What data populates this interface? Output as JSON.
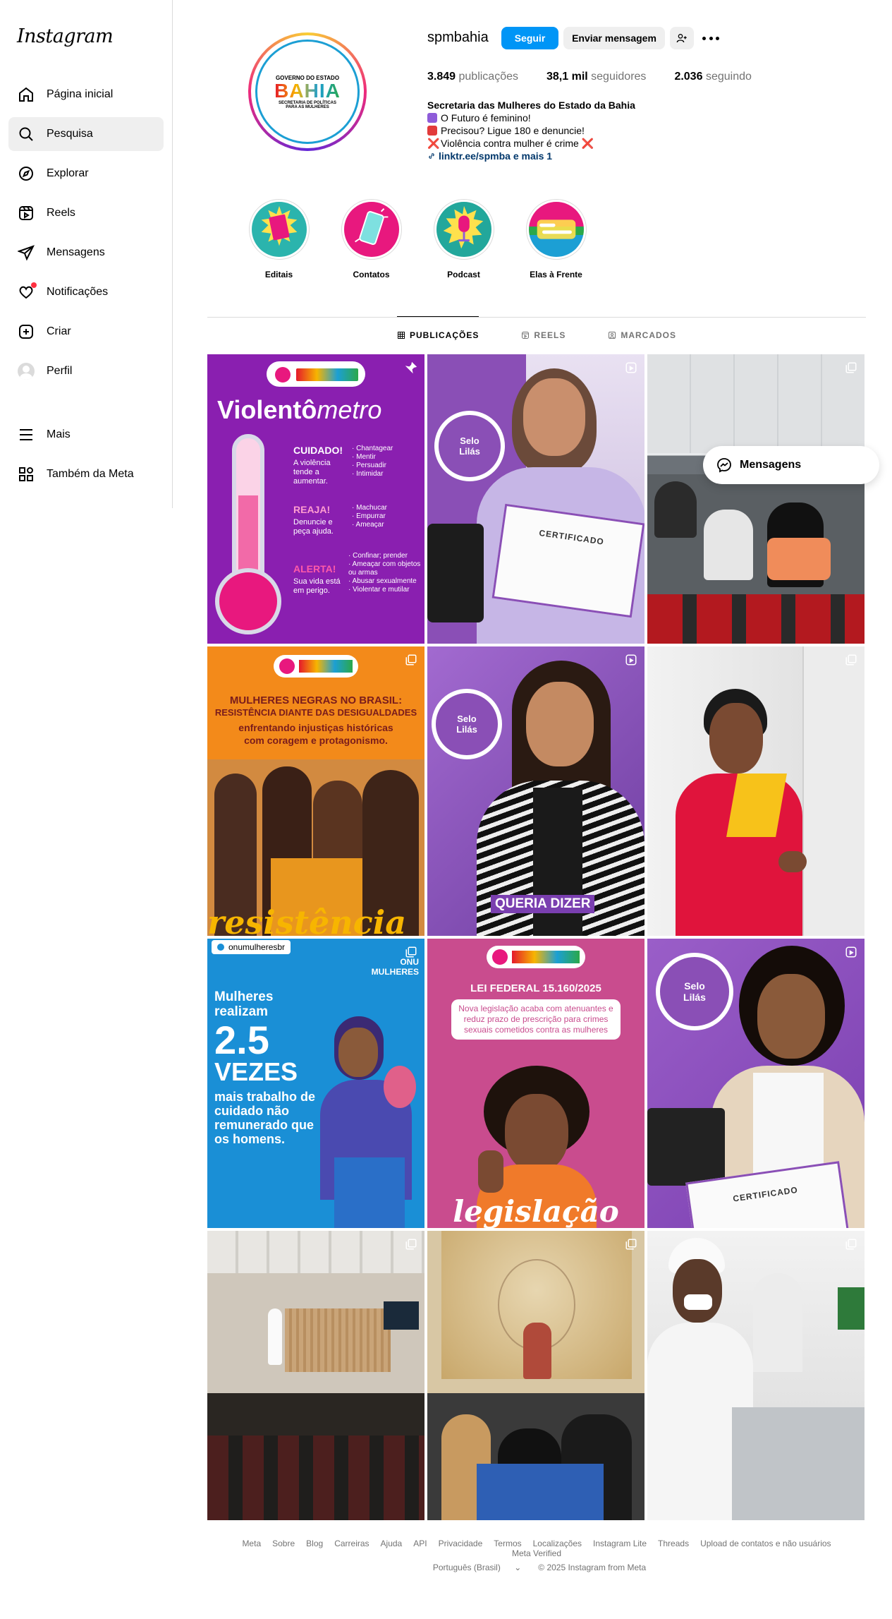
{
  "sidebar": {
    "logo": "Instagram",
    "items": [
      {
        "label": "Página inicial"
      },
      {
        "label": "Pesquisa"
      },
      {
        "label": "Explorar"
      },
      {
        "label": "Reels"
      },
      {
        "label": "Mensagens"
      },
      {
        "label": "Notificações"
      },
      {
        "label": "Criar"
      },
      {
        "label": "Perfil"
      }
    ],
    "bottom": [
      {
        "label": "Mais"
      },
      {
        "label": "Também da Meta"
      }
    ]
  },
  "profile": {
    "username": "spmbahia",
    "follow_label": "Seguir",
    "message_label": "Enviar mensagem",
    "logo": {
      "line1": "GOVERNO DO ESTADO",
      "line2": "BAHIA",
      "line3": "SECRETARIA DE POLÍTICAS PARA AS MULHERES"
    },
    "stats": [
      {
        "value": "3.849",
        "label": "publicações"
      },
      {
        "value": "38,1 mil",
        "label": "seguidores"
      },
      {
        "value": "2.036",
        "label": "seguindo"
      }
    ],
    "bio": {
      "name": "Secretaria das Mulheres do Estado da Bahia",
      "lines": [
        "O Futuro é feminino!",
        "Precisou? Ligue 180 e denuncie!",
        "Violência contra mulher é crime"
      ],
      "x_mark": "❌",
      "link": "linktr.ee/spmba e mais 1"
    }
  },
  "highlights": [
    {
      "label": "Editais",
      "bg": "#2bb4ad"
    },
    {
      "label": "Contatos",
      "bg": "#e8187e"
    },
    {
      "label": "Podcast",
      "bg": "#22a79b"
    },
    {
      "label": "Elas à Frente",
      "bg": "#e8187e"
    }
  ],
  "tabs": [
    {
      "label": "PUBLICAÇÕES"
    },
    {
      "label": "REELS"
    },
    {
      "label": "MARCADOS"
    }
  ],
  "posts": {
    "p1": {
      "title_a": "Violentô",
      "title_b": "metro",
      "levels": [
        {
          "head": "CUIDADO!",
          "desc": "A violência tende a aumentar.",
          "items": "· Chantagear\n· Mentir\n· Persuadir\n· Intimidar"
        },
        {
          "head": "REAJA!",
          "desc": "Denuncie e peça ajuda.",
          "items": "· Machucar\n· Empurrar\n· Ameaçar"
        },
        {
          "head": "ALERTA!",
          "desc": "Sua vida está em perigo.",
          "items": "· Confinar; prender\n· Ameaçar com objetos ou armas\n· Abusar sexualmente\n· Violentar e mutilar"
        }
      ]
    },
    "p2": {
      "badge": "Selo Lilás",
      "cert": "CERTIFICADO"
    },
    "p4": {
      "line1": "MULHERES NEGRAS NO BRASIL:",
      "line2": "RESISTÊNCIA DIANTE DAS DESIGUALDADES",
      "line3": "enfrentando injustiças históricas com coragem e protagonismo.",
      "script": "resistência"
    },
    "p5": {
      "badge": "Selo Lilás",
      "caption": "QUERIA DIZER"
    },
    "p7": {
      "collab": "onumulheresbr",
      "org": "ONU MULHERES",
      "l1": "Mulheres realizam",
      "l2": "2.5",
      "l3": "VEZES",
      "l4": "mais trabalho de cuidado não remunerado que os homens."
    },
    "p8": {
      "head": "LEI FEDERAL 15.160/2025",
      "desc": "Nova legislação acaba com atenuantes e reduz prazo de prescrição para crimes sexuais cometidos contra as mulheres",
      "script": "legislação"
    },
    "p9": {
      "badge": "Selo Lilás",
      "cert": "CERTIFICADO"
    }
  },
  "floating": {
    "label": "Mensagens"
  },
  "footer": {
    "links": [
      "Meta",
      "Sobre",
      "Blog",
      "Carreiras",
      "Ajuda",
      "API",
      "Privacidade",
      "Termos",
      "Localizações",
      "Instagram Lite",
      "Threads",
      "Upload de contatos e não usuários",
      "Meta Verified"
    ],
    "language": "Português (Brasil)",
    "copyright": "© 2025 Instagram from Meta"
  }
}
